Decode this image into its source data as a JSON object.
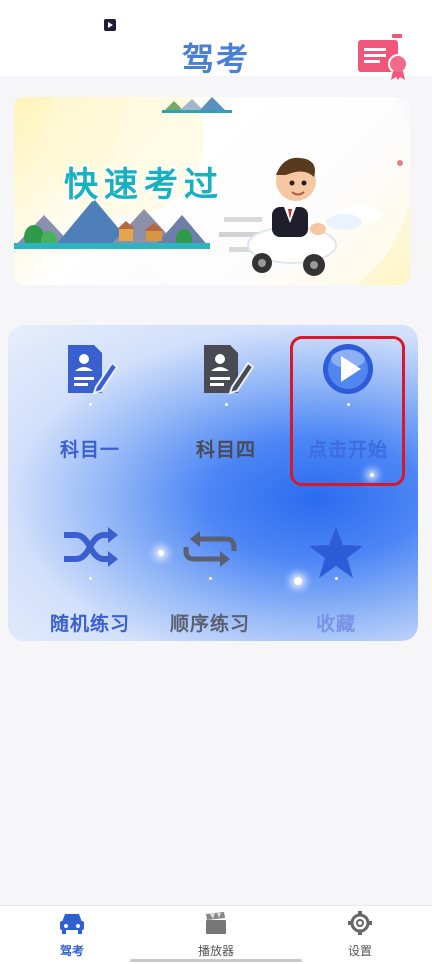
{
  "header": {
    "title": "驾考",
    "certificate_icon": "certificate-icon"
  },
  "banner": {
    "slogan": "快速考过"
  },
  "menu": {
    "items": [
      {
        "label": "科目一",
        "icon": "document-edit-icon",
        "color": "#3a5fcf"
      },
      {
        "label": "科目四",
        "icon": "document-edit-icon",
        "color": "#4a4a55"
      },
      {
        "label": "点击开始",
        "icon": "play-icon",
        "color": "#3d6be0"
      },
      {
        "label": "随机练习",
        "icon": "shuffle-icon",
        "color": "#3a5fcf"
      },
      {
        "label": "顺序练习",
        "icon": "repeat-icon",
        "color": "#5a5f72"
      },
      {
        "label": "收藏",
        "icon": "star-icon",
        "color": "#7a93e8"
      }
    ]
  },
  "bottom_nav": {
    "items": [
      {
        "label": "驾考",
        "icon": "car-icon",
        "active": true
      },
      {
        "label": "播放器",
        "icon": "clapperboard-icon",
        "active": false
      },
      {
        "label": "设置",
        "icon": "gear-icon",
        "active": false
      }
    ]
  },
  "colors": {
    "accent": "#4a7fd6",
    "highlight_box": "#d8162c",
    "slogan": "#19b0c0"
  }
}
